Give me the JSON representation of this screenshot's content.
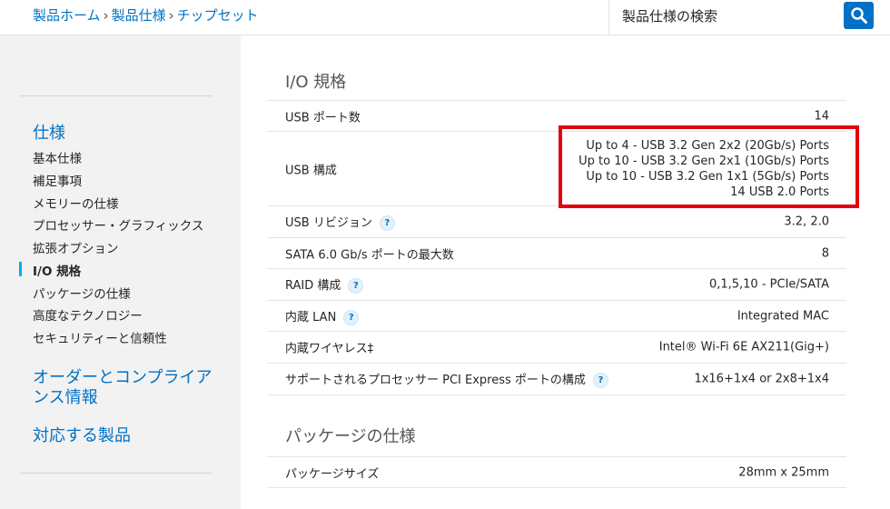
{
  "breadcrumb": {
    "items": [
      "製品ホーム",
      "製品仕様",
      "チップセット"
    ],
    "separator": "›"
  },
  "search": {
    "placeholder": "製品仕様の検索",
    "icon": "search-icon"
  },
  "sidebar": {
    "heading_spec": "仕様",
    "items": [
      {
        "label": "基本仕様",
        "active": false
      },
      {
        "label": "補足事項",
        "active": false
      },
      {
        "label": "メモリーの仕様",
        "active": false
      },
      {
        "label": "プロセッサー・グラフィックス",
        "active": false
      },
      {
        "label": "拡張オプション",
        "active": false
      },
      {
        "label": "I/O 規格",
        "active": true
      },
      {
        "label": "パッケージの仕様",
        "active": false
      },
      {
        "label": "高度なテクノロジー",
        "active": false
      },
      {
        "label": "セキュリティーと信頼性",
        "active": false
      }
    ],
    "heading_order_line1": "オーダーとコンプライア",
    "heading_order_line2": "ンス情報",
    "heading_products": "対応する製品"
  },
  "io_section": {
    "title": "I/O 規格",
    "rows": [
      {
        "label": "USB ポート数",
        "value": "14",
        "help": false
      },
      {
        "label": "USB 構成",
        "values": [
          "Up to 4 - USB 3.2 Gen 2x2 (20Gb/s) Ports",
          "Up to 10 - USB 3.2 Gen 2x1 (10Gb/s) Ports",
          "Up to 10 - USB 3.2 Gen 1x1 (5Gb/s) Ports",
          "14 USB 2.0 Ports"
        ],
        "help": false
      },
      {
        "label": "USB リビジョン",
        "value": "3.2, 2.0",
        "help": true
      },
      {
        "label": "SATA 6.0 Gb/s ポートの最大数",
        "value": "8",
        "help": false
      },
      {
        "label": "RAID 構成",
        "value": "0,1,5,10 - PCIe/SATA",
        "help": true
      },
      {
        "label": "内蔵 LAN",
        "value": "Integrated MAC",
        "help": true
      },
      {
        "label": "内蔵ワイヤレス‡",
        "value": "Intel® Wi-Fi 6E AX211(Gig+)",
        "help": false
      },
      {
        "label": "サポートされるプロセッサー PCI Express ポートの構成",
        "value": "1x16+1x4 or 2x8+1x4",
        "help": true
      }
    ]
  },
  "package_section": {
    "title": "パッケージの仕様",
    "rows": [
      {
        "label": "パッケージサイズ",
        "value": "28mm x 25mm"
      }
    ]
  },
  "help_glyph": "?",
  "colors": {
    "link_blue": "#0071c5",
    "highlight_red": "#e3000f",
    "active_marker": "#00aeef",
    "sidebar_bg": "#f2f2f2"
  }
}
